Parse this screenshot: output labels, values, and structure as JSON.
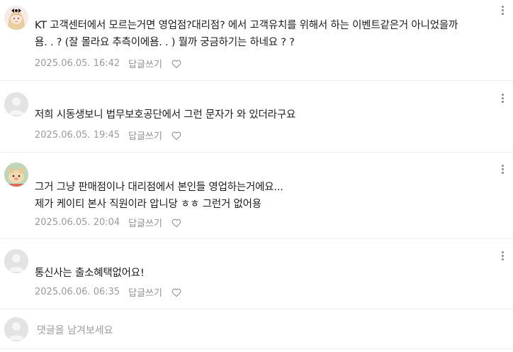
{
  "comments": [
    {
      "avatar": "profile-photo-illustrated-girl",
      "lines": [
        "KT 고객센터에서 모르는거면 영업점?대리점? 에서 고객유치를 위해서 하는 이벤트같은거 아니었을까",
        "욤. . ? (잘 몰라요 추측이에욤. . ) 뭘까 궁금하기는 하네요 ? ?"
      ],
      "date": "2025.06.05. 16:42",
      "reply_label": "답글쓰기"
    },
    {
      "avatar": "default-profile",
      "lines": [
        "저희 시동생보니 법무보호공단에서 그런 문자가 와 있더라구요"
      ],
      "date": "2025.06.05. 19:45",
      "reply_label": "답글쓰기"
    },
    {
      "avatar": "profile-photo-plush-toy",
      "lines": [
        "그거 그냥 판매점이나 대리점에서 본인들 영업하는거에요...",
        "제가 케이티 본사 직원이라 압니당 ㅎㅎ 그런거 없어용"
      ],
      "date": "2025.06.05. 20:04",
      "reply_label": "답글쓰기"
    },
    {
      "avatar": "default-profile",
      "lines": [
        "통신사는 출소혜택없어요!"
      ],
      "date": "2025.06.06. 06:35",
      "reply_label": "답글쓰기"
    }
  ],
  "comment_input": {
    "placeholder": "댓글을 남겨보세요",
    "avatar": "default-profile"
  },
  "icons": {
    "more": "more-vertical-icon",
    "like": "heart-icon"
  },
  "colors": {
    "text": "#1d1d1d",
    "meta": "#9a9a9a",
    "divider": "#ececec",
    "avatar_placeholder": "#e5e5e5"
  }
}
